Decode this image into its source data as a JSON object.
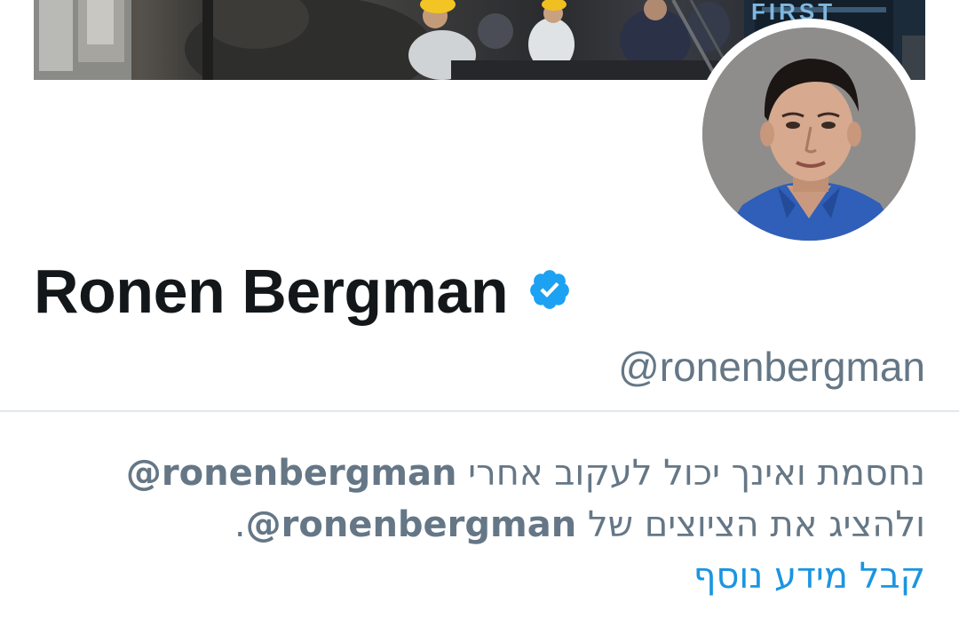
{
  "banner": {
    "book_text": "FIRST"
  },
  "profile": {
    "display_name": "Ronen Bergman",
    "handle": "@ronenbergman",
    "verified_icon": "verified-badge-icon"
  },
  "blocked_notice": {
    "line1_text": "נחסמת ואינך יכול לעקוב אחרי ",
    "line1_handle": "@ronenbergman",
    "line2_text": "ולהציג את הציוצים של ",
    "line2_handle": "@ronenbergman",
    "line2_end": ".",
    "learn_more": "קבל מידע נוסף"
  },
  "colors": {
    "text_primary": "#14171a",
    "text_secondary": "#657786",
    "link": "#1b95e0",
    "verified": "#1da1f2",
    "divider": "#e1e8ed"
  }
}
